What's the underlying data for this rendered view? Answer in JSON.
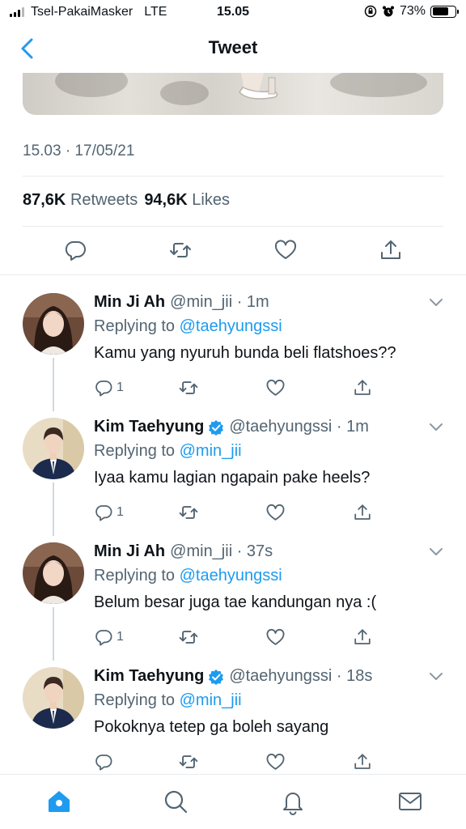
{
  "status_bar": {
    "carrier": "Tsel-PakaiMasker",
    "network": "LTE",
    "time": "15.05",
    "battery": "73%",
    "battery_level": 0.73
  },
  "header": {
    "title": "Tweet",
    "back_icon": "chevron-left-icon"
  },
  "tweet": {
    "timestamp": "15.03 · 17/05/21",
    "retweets_count": "87,6K",
    "retweets_label": "Retweets",
    "likes_count": "94,6K",
    "likes_label": "Likes",
    "actions": [
      "reply-icon",
      "retweet-icon",
      "like-icon",
      "share-icon"
    ]
  },
  "replies": [
    {
      "name": "Min Ji Ah",
      "verified": false,
      "handle_time": "@min_jii · 1m",
      "replying_prefix": "Replying to",
      "replying_to": "@taehyungssi",
      "text": "Kamu yang nyuruh bunda beli flatshoes??",
      "reply_count": "1"
    },
    {
      "name": "Kim Taehyung",
      "verified": true,
      "handle_time": "@taehyungssi · 1m",
      "replying_prefix": "Replying to",
      "replying_to": "@min_jii",
      "text": "Iyaa kamu lagian ngapain pake heels?",
      "reply_count": "1"
    },
    {
      "name": "Min Ji Ah",
      "verified": false,
      "handle_time": "@min_jii · 37s",
      "replying_prefix": "Replying to",
      "replying_to": "@taehyungssi",
      "text": "Belum besar juga tae kandungan nya :(",
      "reply_count": "1"
    },
    {
      "name": "Kim Taehyung",
      "verified": true,
      "handle_time": "@taehyungssi · 18s",
      "replying_prefix": "Replying to",
      "replying_to": "@min_jii",
      "text": "Pokoknya tetep ga boleh sayang",
      "reply_count": ""
    }
  ],
  "tab_bar": {
    "items": [
      "home-icon",
      "search-icon",
      "notifications-icon",
      "messages-icon"
    ],
    "active": "home-icon"
  },
  "colors": {
    "accent": "#1d9bf0",
    "secondary_text": "#536471",
    "verified": "#1d9bf0"
  }
}
